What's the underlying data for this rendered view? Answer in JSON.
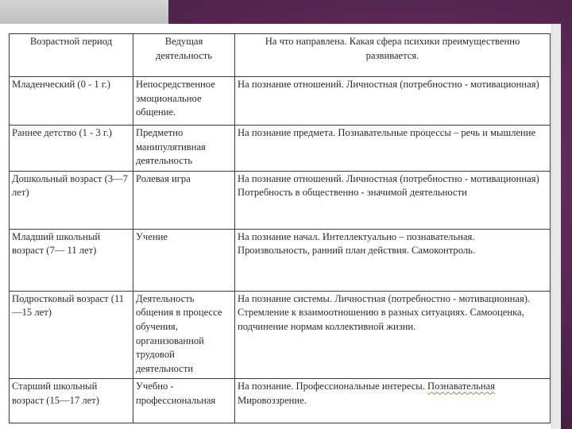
{
  "table": {
    "headers": [
      "Возрастной период",
      "Ведущая деятельность",
      "На что направлена. Какая сфера психики преимущественно развивается."
    ],
    "rows": [
      {
        "period": "Младенческий (0 - 1 г.)",
        "activity": "Непосредственное эмоциональное общение.",
        "direction": "На познание отношений. Личностная (потребностно - мотивационная)"
      },
      {
        "period": "Раннее детство (1 - 3 г.)",
        "activity": "Предметно манипулятивная деятельность",
        "direction": "На познание предмета. Познавательные процессы – речь и мышление"
      },
      {
        "period": "Дошкольный возраст (3—7 лет)",
        "activity": "Ролевая игра",
        "direction": "На познание отношений. Личностная (потребностно - мотивационная) Потребность в общественно - значимой деятельности"
      },
      {
        "period": "Младший школьный возраст (7— 11 лет)",
        "activity": "Учение",
        "direction": "На познание начал. Интеллектуально – познавательная. Произвольность, ранний план действия. Самоконтроль."
      },
      {
        "period": "Подростковый возраст (11—15 лет)",
        "activity": "Деятельность общения в процессе обучения, организованной трудовой деятельности",
        "direction": "На познание системы. Личностная (потребностно - мотивационная). Стремление к взаимоотношению в разных ситуациях. Самооценка, подчинение нормам коллективной жизни."
      },
      {
        "period": "Старший школьный возраст (15—17 лет)",
        "activity": "Учебно - профессиональная",
        "direction_main": "На познание. Профессиональные интересы.",
        "direction_highlight": "Познавательная",
        "direction_tail": "Мировоззрение."
      }
    ]
  }
}
